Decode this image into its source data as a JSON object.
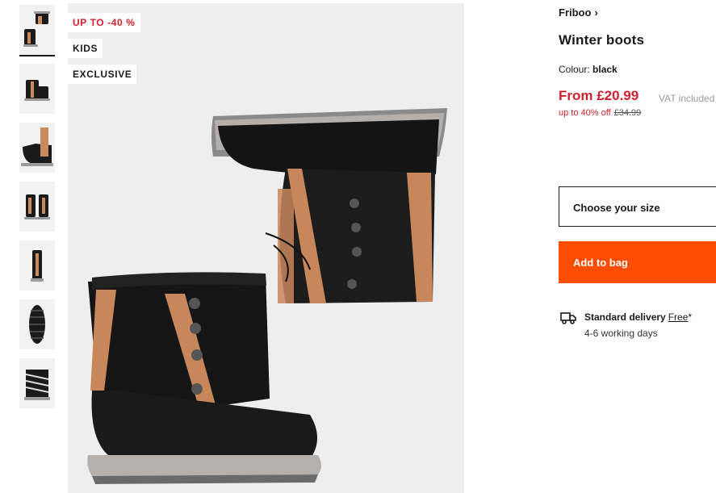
{
  "gallery": {
    "badges": [
      "UP TO -40 %",
      "KIDS",
      "EXCLUSIVE"
    ],
    "thumbnail_count": 7
  },
  "product": {
    "brand": "Friboo",
    "title": "Winter boots",
    "colour_label": "Colour:",
    "colour_value": "black",
    "price": "From £20.99",
    "vat_note": "VAT included",
    "discount": "up to 40% off",
    "original_price": "£34.99"
  },
  "actions": {
    "size_placeholder": "Choose your size",
    "add_to_bag": "Add to bag"
  },
  "delivery": {
    "icon": "truck-icon",
    "label": "Standard delivery",
    "price": "Free",
    "asterisk": "*",
    "time": "4-6 working days"
  },
  "colors": {
    "sale": "#d2202f",
    "accent": "#ff4d00",
    "text": "#1a1a1a"
  }
}
